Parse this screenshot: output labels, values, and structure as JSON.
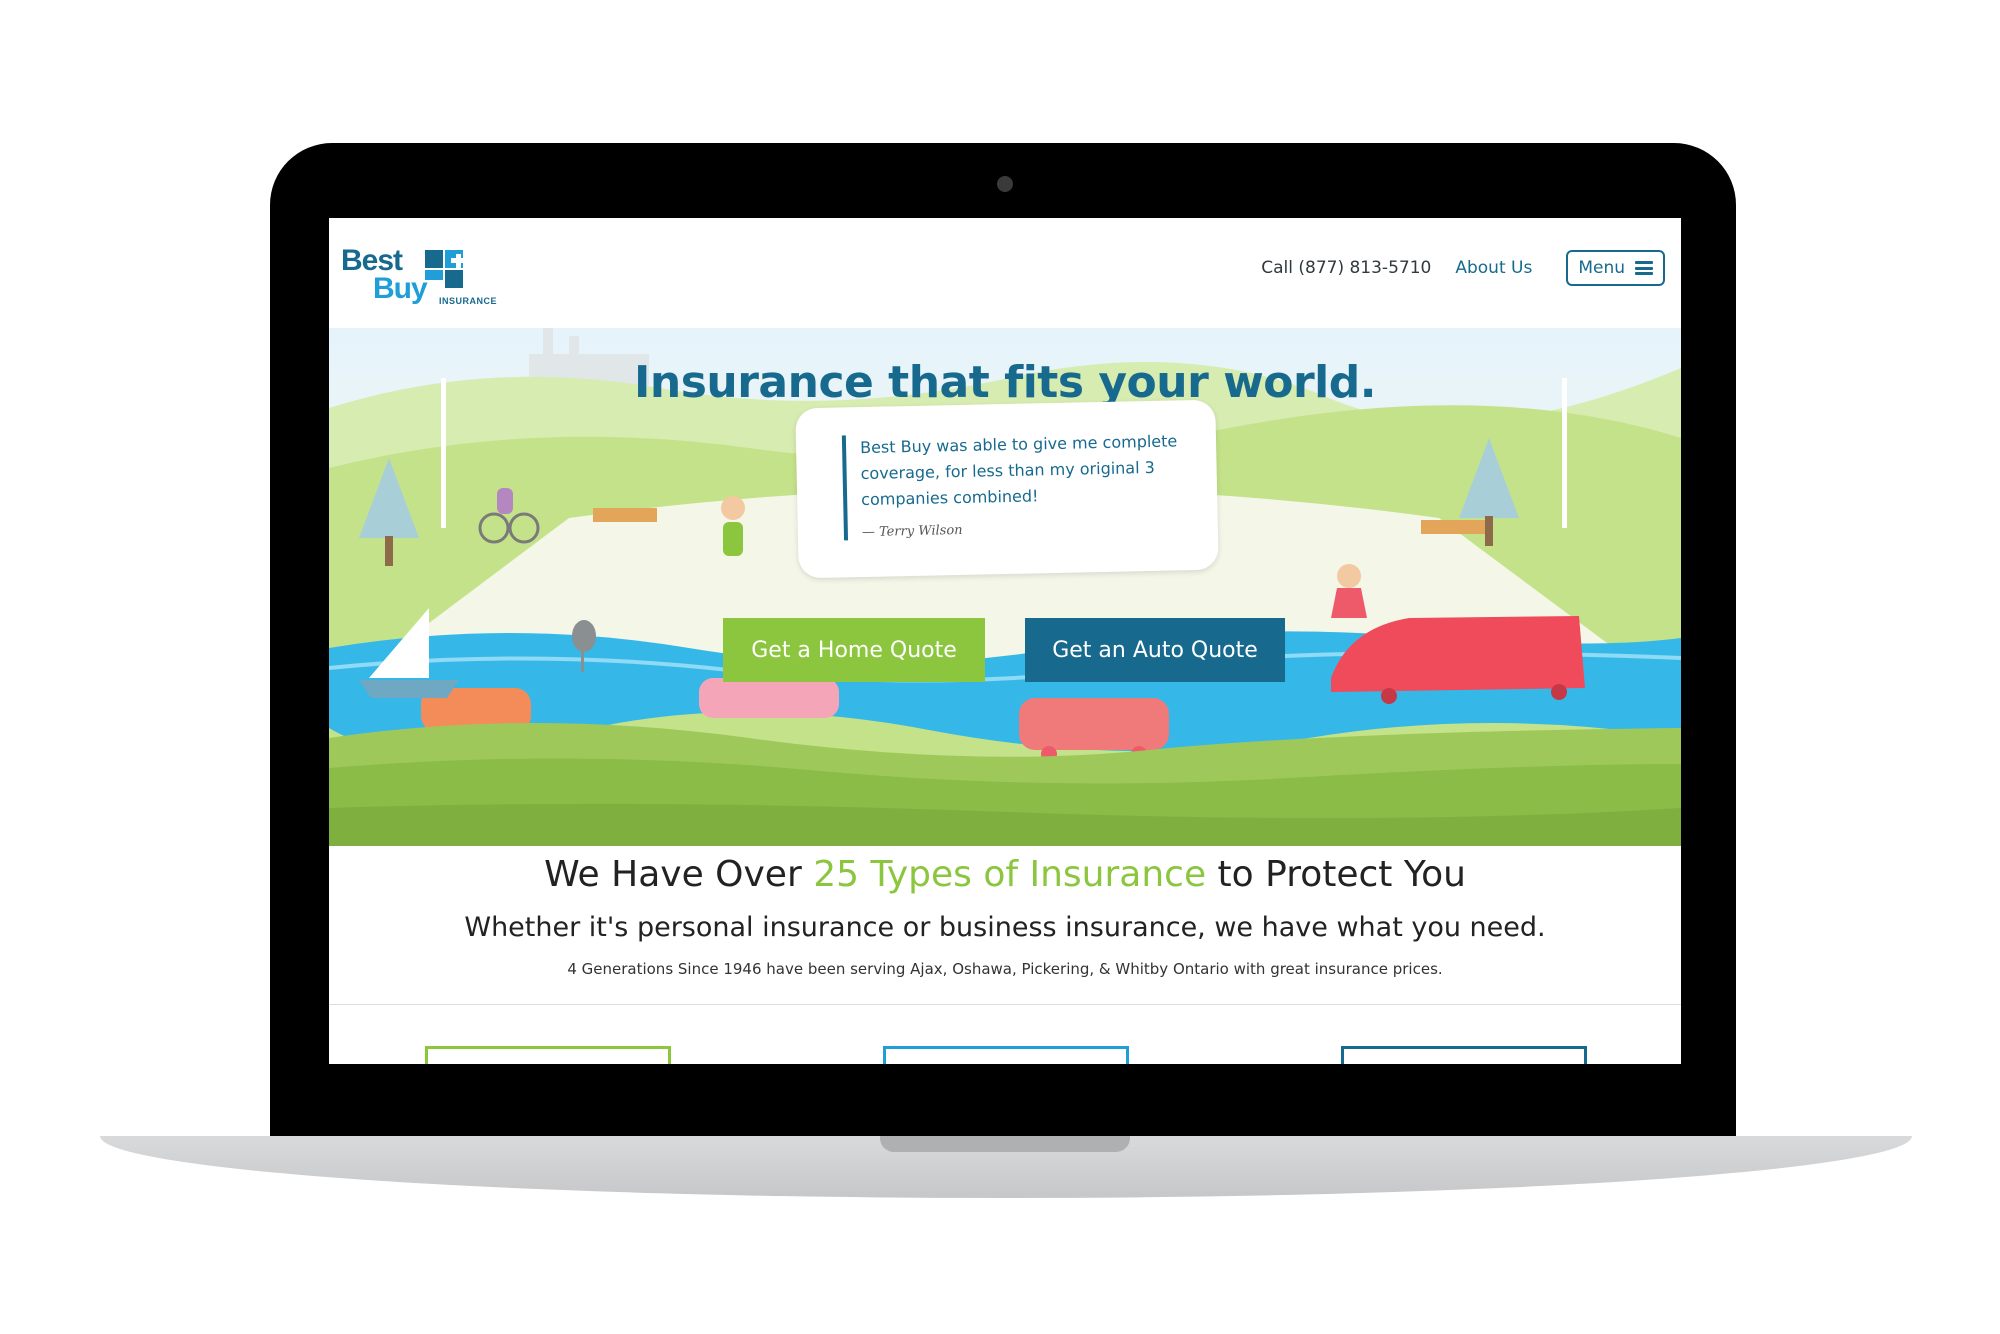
{
  "header": {
    "logo": {
      "line1": "Best",
      "line2": "Buy",
      "subtitle": "INSURANCE"
    },
    "call_label": "Call (877) 813-5710",
    "about_label": "About Us",
    "menu_label": "Menu",
    "menu_icon": "hamburger-icon"
  },
  "hero": {
    "title": "Insurance that fits your world.",
    "testimonial": {
      "quote": "Best Buy was able to give me complete coverage, for less than my original 3 companies combined!",
      "author": "— Terry Wilson"
    },
    "buttons": {
      "home_quote": "Get a Home Quote",
      "auto_quote": "Get an Auto Quote"
    }
  },
  "intro": {
    "heading_pre": "We Have Over ",
    "heading_highlight": "25 Types of Insurance",
    "heading_post": " to Protect You",
    "subheading": "Whether it's personal insurance or business insurance, we have what you need.",
    "tagline": "4 Generations Since 1946 have been serving Ajax, Oshawa, Pickering, & Whitby Ontario with great insurance prices."
  },
  "colors": {
    "brand_blue": "#176a8e",
    "brand_light_blue": "#1f9ed8",
    "brand_green": "#8cc63f",
    "laptop_bezel": "#000000"
  }
}
